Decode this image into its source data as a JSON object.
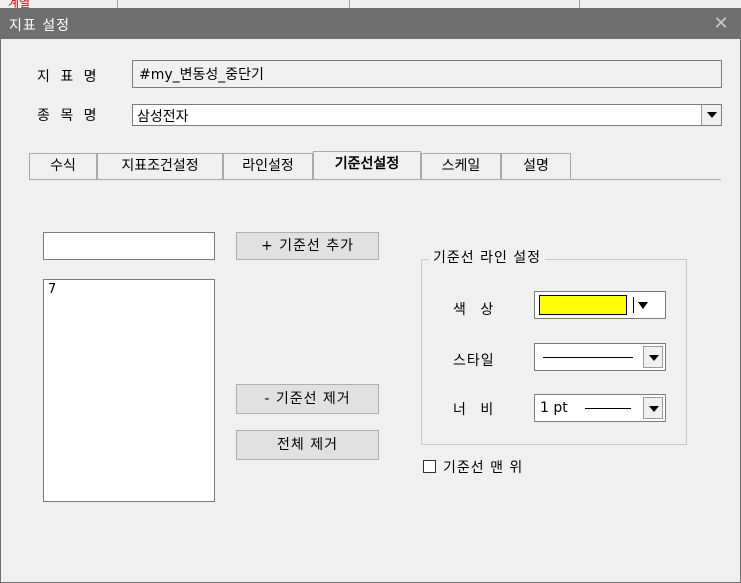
{
  "background": {
    "partial_text": "계열"
  },
  "dialog": {
    "title": "지표 설정",
    "close_glyph": "✕",
    "indicator_label": "지 표 명",
    "indicator_value": "#my_변동성_중단기",
    "stock_label": "종 목 명",
    "stock_value": "삼성전자",
    "tabs": [
      {
        "label": "수식"
      },
      {
        "label": "지표조건설정"
      },
      {
        "label": "라인설정"
      },
      {
        "label": "기준선설정",
        "active": true
      },
      {
        "label": "스케일"
      },
      {
        "label": "설명"
      }
    ],
    "baseline_input_value": "",
    "add_button": "+ 기준선 추가",
    "remove_button": "- 기준선 제거",
    "remove_all_button": "전체 제거",
    "baseline_list": [
      "7"
    ],
    "group_title": "기준선 라인 설정",
    "color_label": "색  상",
    "color_value": "#ffff00",
    "style_label": "스타일",
    "width_label": "너  비",
    "width_value": "1 pt",
    "top_checkbox_label": "기준선 맨 위",
    "top_checkbox_checked": false
  },
  "colors": {
    "titlebar": "#6f6f6f",
    "dialog_bg": "#f0f0f0",
    "swatch": "#ffff00"
  }
}
